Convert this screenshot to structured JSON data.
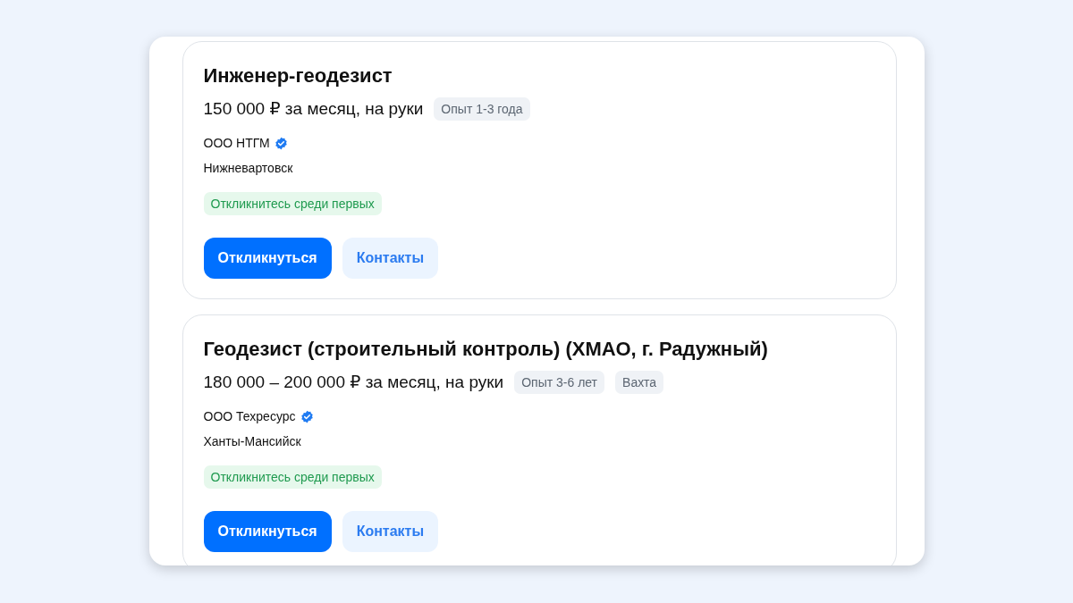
{
  "vacancies": [
    {
      "title": "Инженер-геодезист",
      "salary": "150 000 ₽ за месяц, на руки",
      "tags": [
        "Опыт 1-3 года"
      ],
      "company": "ООО НТГМ",
      "verified": true,
      "city": "Нижневартовск",
      "badge": "Откликнитесь среди первых",
      "buttons": [
        {
          "label": "Откликнуться",
          "kind": "primary"
        },
        {
          "label": "Контакты",
          "kind": "secondary"
        }
      ]
    },
    {
      "title": "Геодезист (строительный контроль) (ХМАО, г. Радужный)",
      "salary": "180 000 – 200 000 ₽ за месяц, на руки",
      "tags": [
        "Опыт 3-6 лет",
        "Вахта"
      ],
      "company": "ООО Техресурс",
      "verified": true,
      "city": "Ханты-Мансийск",
      "badge": "Откликнитесь среди первых",
      "buttons": [
        {
          "label": "Откликнуться",
          "kind": "primary"
        },
        {
          "label": "Контакты",
          "kind": "secondary"
        }
      ]
    }
  ]
}
